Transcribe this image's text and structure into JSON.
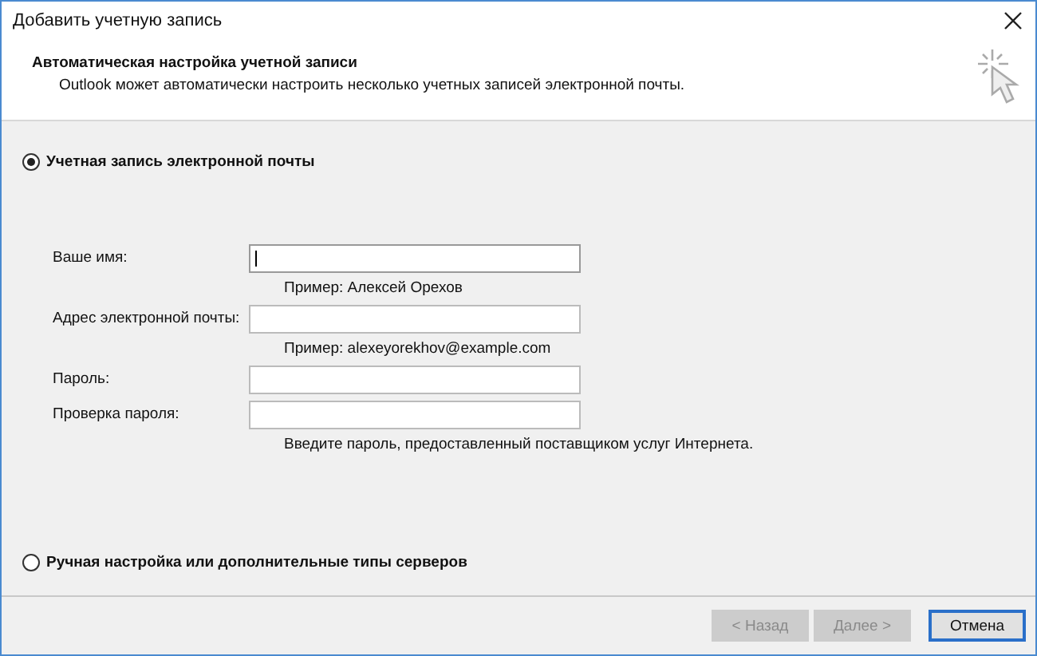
{
  "window": {
    "title": "Добавить учетную запись"
  },
  "header": {
    "title": "Автоматическая настройка учетной записи",
    "subtitle": "Outlook может автоматически настроить несколько учетных записей электронной почты."
  },
  "options": [
    {
      "label": "Учетная запись электронной почты",
      "selected": true,
      "fields": [
        {
          "label": "Ваше имя:",
          "focused": true,
          "hint": "Пример: Алексей Орехов"
        },
        {
          "label": "Адрес электронной почты:",
          "focused": false,
          "hint": "Пример: alexeyorekhov@example.com"
        },
        {
          "label": "Пароль:",
          "focused": false
        },
        {
          "label": "Проверка пароля:",
          "focused": false,
          "hint": "Введите пароль, предоставленный поставщиком услуг Интернета."
        }
      ]
    },
    {
      "label": "Ручная настройка или дополнительные типы серверов",
      "selected": false
    }
  ],
  "buttons": [
    {
      "label": "< Назад",
      "disabled": true,
      "default": false
    },
    {
      "label": "Далее >",
      "disabled": true,
      "default": false
    },
    {
      "label": "Отмена",
      "disabled": false,
      "default": true
    }
  ]
}
